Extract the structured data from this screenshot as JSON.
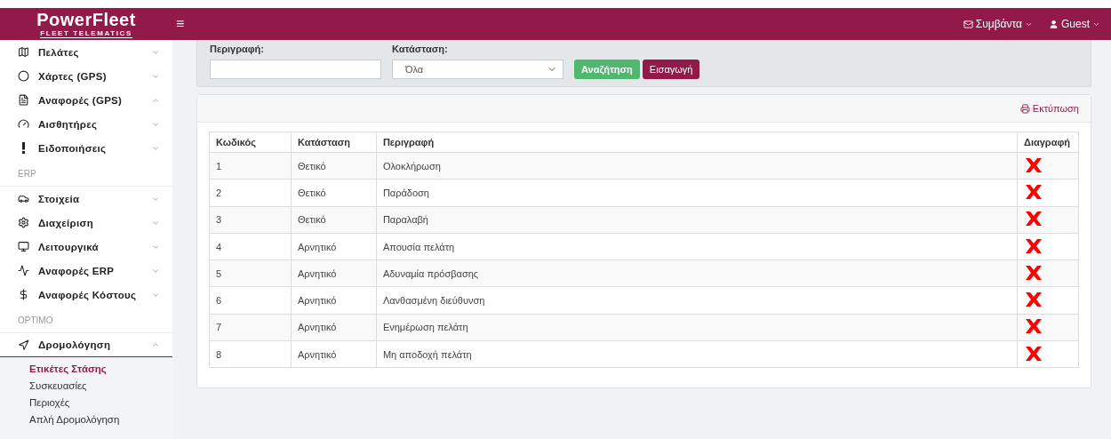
{
  "header": {
    "logo": "PowerFleet",
    "logo_tagline": "FLEET TELEMATICS",
    "menu_button": "≡",
    "events": "Συμβάντα",
    "user": "Guest"
  },
  "sidebar": {
    "groups": [
      {
        "items": [
          {
            "label": "Πελάτες",
            "expanded": false
          },
          {
            "label": "Χάρτες (GPS)",
            "expanded": false
          },
          {
            "label": "Αναφορές (GPS)",
            "expanded": true
          },
          {
            "label": "Αισθητήρες",
            "expanded": false
          },
          {
            "label": "Ειδοποιήσεις",
            "expanded": false
          }
        ]
      },
      {
        "heading": "ERP",
        "items": [
          {
            "label": "Στοιχεία",
            "expanded": false
          },
          {
            "label": "Διαχείριση",
            "expanded": false
          },
          {
            "label": "Λειτουργικά",
            "expanded": false
          },
          {
            "label": "Αναφορές ERP",
            "expanded": false
          },
          {
            "label": "Αναφορές Κόστους",
            "expanded": false
          }
        ]
      },
      {
        "heading": "OPTIMO",
        "items": [
          {
            "label": "Δρομολόγηση",
            "expanded": true,
            "children": [
              {
                "label": "Ετικέτες Στάσης",
                "selected": true
              },
              {
                "label": "Συσκευασίες",
                "selected": false
              },
              {
                "label": "Περιοχές",
                "selected": false
              },
              {
                "label": "Απλή Δρομολόγηση",
                "selected": false
              }
            ]
          }
        ]
      }
    ]
  },
  "filters": {
    "description_label": "Περιγραφή:",
    "status_label": "Κατάσταση:",
    "status_value": "Όλα",
    "search_button": "Αναζήτηση",
    "insert_button": "Εισαγωγή"
  },
  "print_link": "Εκτύπωση",
  "table": {
    "columns": [
      "Κωδικός",
      "Κατάσταση",
      "Περιγραφή",
      "Διαγραφή"
    ],
    "rows": [
      {
        "code": "1",
        "status": "Θετικό",
        "description": "Ολοκλήρωση"
      },
      {
        "code": "2",
        "status": "Θετικό",
        "description": "Παράδοση"
      },
      {
        "code": "3",
        "status": "Θετικό",
        "description": "Παραλαβή"
      },
      {
        "code": "4",
        "status": "Αρνητικό",
        "description": "Απουσία πελάτη"
      },
      {
        "code": "5",
        "status": "Αρνητικό",
        "description": "Αδυναμία πρόσβασης"
      },
      {
        "code": "6",
        "status": "Αρνητικό",
        "description": "Λανθασμένη διεύθυνση"
      },
      {
        "code": "7",
        "status": "Αρνητικό",
        "description": "Ενημέρωση πελάτη"
      },
      {
        "code": "8",
        "status": "Αρνητικό",
        "description": "Μη αποδοχή πελάτη"
      }
    ]
  }
}
